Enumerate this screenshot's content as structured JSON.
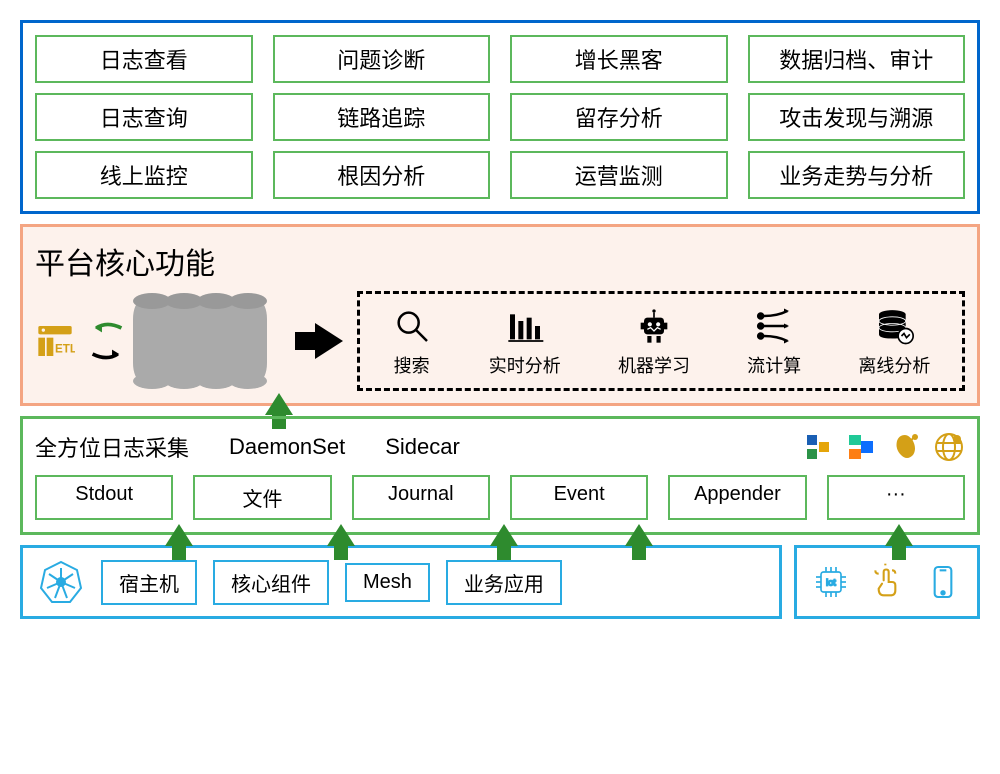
{
  "apps": {
    "r1c1": "日志查看",
    "r1c2": "问题诊断",
    "r1c3": "增长黑客",
    "r1c4": "数据归档、审计",
    "r2c1": "日志查询",
    "r2c2": "链路追踪",
    "r2c3": "留存分析",
    "r2c4": "攻击发现与溯源",
    "r3c1": "线上监控",
    "r3c2": "根因分析",
    "r3c3": "运营监测",
    "r3c4": "业务走势与分析"
  },
  "core": {
    "title": "平台核心功能",
    "etl": "ETL",
    "caps": {
      "search": "搜索",
      "realtime": "实时分析",
      "ml": "机器学习",
      "stream": "流计算",
      "offline": "离线分析"
    }
  },
  "collect": {
    "title": "全方位日志采集",
    "mode1": "DaemonSet",
    "mode2": "Sidecar",
    "sources": {
      "stdout": "Stdout",
      "file": "文件",
      "journal": "Journal",
      "event": "Event",
      "appender": "Appender",
      "more": "···"
    }
  },
  "infra": {
    "host": "宿主机",
    "core": "核心组件",
    "mesh": "Mesh",
    "app": "业务应用",
    "iot": "iot"
  }
}
